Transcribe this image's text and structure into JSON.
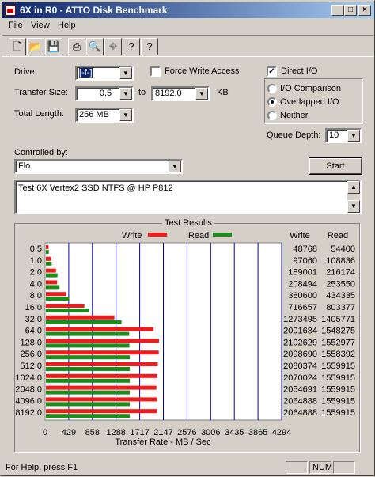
{
  "window": {
    "title": "6X in R0 - ATTO Disk Benchmark"
  },
  "menu": {
    "file": "File",
    "view": "View",
    "help": "Help"
  },
  "toolbar": {
    "icons": [
      "new-icon",
      "open-icon",
      "save-icon",
      "print-icon",
      "print-preview-icon",
      "move-icon",
      "help-icon",
      "context-help-icon"
    ]
  },
  "form": {
    "drive_label": "Drive:",
    "drive_value": "[-f-]",
    "force_write_label": "Force Write Access",
    "force_write_checked": false,
    "direct_io_label": "Direct I/O",
    "direct_io_checked": true,
    "transfer_size_label": "Transfer Size:",
    "transfer_from": "0.5",
    "to_label": "to",
    "transfer_to": "8192.0",
    "kb_label": "KB",
    "total_length_label": "Total Length:",
    "total_length": "256 MB",
    "io_comparison": "I/O Comparison",
    "overlapped_io": "Overlapped I/O",
    "neither": "Neither",
    "selected_mode": "overlapped",
    "queue_depth_label": "Queue Depth:",
    "queue_depth": "10",
    "controlled_by_label": "Controlled by:",
    "controlled_by": "Flo",
    "start_label": "Start",
    "description": "Test 6X Vertex2 SSD NTFS @ HP P812"
  },
  "results": {
    "title": "Test Results",
    "write_legend": "Write",
    "read_legend": "Read",
    "col_write": "Write",
    "col_read": "Read",
    "write_color": "#ee1c1c",
    "read_color": "#1c8c1c"
  },
  "chart_data": {
    "type": "bar",
    "xlabel": "Transfer Rate - MB / Sec",
    "xlim": [
      0,
      4294
    ],
    "x_ticks": [
      "0",
      "429",
      "858",
      "1288",
      "1717",
      "2147",
      "2576",
      "3006",
      "3435",
      "3865",
      "4294"
    ],
    "categories": [
      "0.5",
      "1.0",
      "2.0",
      "4.0",
      "8.0",
      "16.0",
      "32.0",
      "64.0",
      "128.0",
      "256.0",
      "512.0",
      "1024.0",
      "2048.0",
      "4096.0",
      "8192.0"
    ],
    "series": [
      {
        "name": "Write",
        "values": [
          48768,
          97060,
          189001,
          208494,
          380600,
          716657,
          1273495,
          2001684,
          2102629,
          2098690,
          2080374,
          2070024,
          2054691,
          2064888,
          2064888
        ]
      },
      {
        "name": "Read",
        "values": [
          54400,
          108836,
          216174,
          253550,
          434335,
          803377,
          1405771,
          1548275,
          1552977,
          1558392,
          1559915,
          1559915,
          1559915,
          1559915,
          1559915
        ]
      }
    ]
  },
  "status": {
    "help_text": "For Help, press F1",
    "num": "NUM"
  }
}
